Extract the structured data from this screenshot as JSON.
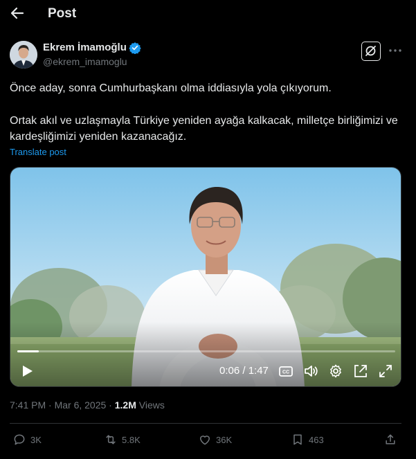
{
  "header": {
    "title": "Post"
  },
  "author": {
    "name": "Ekrem İmamoğlu",
    "handle": "@ekrem_imamoglu"
  },
  "tweet": {
    "line1": "Önce aday, sonra Cumhurbaşkanı olma iddiasıyla yola çıkıyorum.",
    "line2": "Ortak akıl ve uzlaşmayla Türkiye yeniden ayağa kalkacak, milletçe birliğimizi ve kardeşliğimizi yeniden kazanacağız.",
    "translate": "Translate post"
  },
  "video": {
    "time": "0:06 / 1:47",
    "progress": 0.056
  },
  "meta": {
    "time_date": "7:41 PM · Mar 6, 2025 · ",
    "views": "1.2M",
    "views_label": " Views"
  },
  "actions": {
    "replies": "3K",
    "reposts": "5.8K",
    "likes": "36K",
    "bookmarks": "463"
  },
  "colors": {
    "accent": "#1d9bf0",
    "muted": "#71767b",
    "text": "#e7e9ea"
  },
  "icons": [
    "back-arrow-icon",
    "verified-badge-icon",
    "grok-icon",
    "more-icon",
    "play-icon",
    "captions-icon",
    "volume-icon",
    "settings-icon",
    "pip-icon",
    "fullscreen-icon",
    "reply-icon",
    "repost-icon",
    "like-icon",
    "bookmark-icon",
    "share-icon"
  ]
}
